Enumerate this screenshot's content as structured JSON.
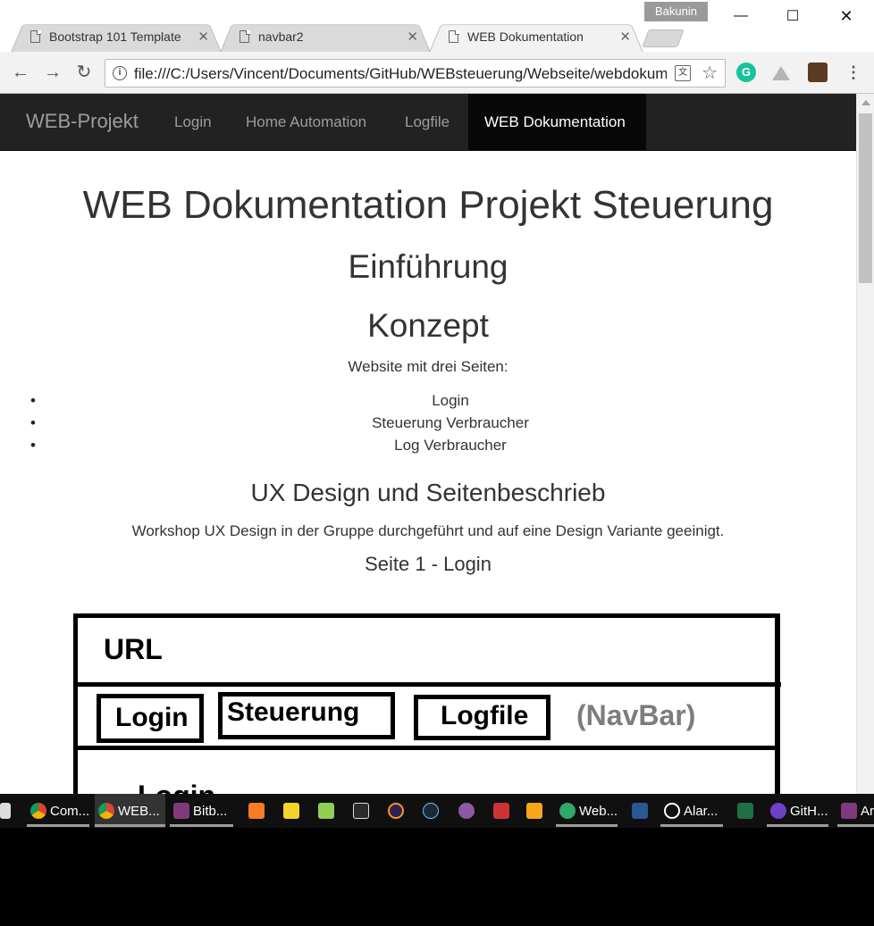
{
  "browser": {
    "profile_name": "Bakunin",
    "tabs": [
      {
        "title": "Bootstrap 101 Template",
        "active": false
      },
      {
        "title": "navbar2",
        "active": false
      },
      {
        "title": "WEB Dokumentation",
        "active": true
      }
    ],
    "url": "file:///C:/Users/Vincent/Documents/GitHub/WEBsteuerung/Webseite/webdokumentation.html",
    "colors": {
      "grammarly": "#15c39a",
      "drive": "#b5b5b5",
      "tab_active": "#f2f2f2",
      "tab_inactive": "#dadada"
    }
  },
  "page": {
    "navbar": {
      "brand": "WEB-Projekt",
      "items": [
        "Login",
        "Home Automation",
        "Logfile",
        "WEB Dokumentation"
      ],
      "active_index": 3
    },
    "title": "WEB Dokumentation Projekt Steuerung",
    "intro_heading": "Einführung",
    "concept_heading": "Konzept",
    "concept_text": "Website mit drei Seiten:",
    "pages_list": [
      "Login",
      "Steuerung Verbraucher",
      "Log Verbraucher"
    ],
    "ux_heading": "UX Design und Seitenbeschrieb",
    "ux_text": "Workshop UX Design in der Gruppe durchgeführt und auf eine Design Variante geeinigt.",
    "page1_heading": "Seite 1 - Login",
    "sketch": {
      "url_label": "URL",
      "nav_buttons": [
        "Login",
        "Steuerung",
        "Logfile"
      ],
      "navbar_note": "(NavBar)",
      "content_label": "Login"
    }
  },
  "taskbar": {
    "items": [
      {
        "label": "Com...",
        "icon": "chrome-icon"
      },
      {
        "label": "WEB...",
        "icon": "chrome-icon"
      },
      {
        "label": "Bitb...",
        "icon": "onenote-icon"
      },
      {
        "label": "Web...",
        "icon": "web-icon"
      },
      {
        "label": "Alar...",
        "icon": "alarm-icon"
      },
      {
        "label": "GitH...",
        "icon": "github-icon"
      },
      {
        "label": "Ar",
        "icon": "onenote-icon"
      }
    ]
  }
}
